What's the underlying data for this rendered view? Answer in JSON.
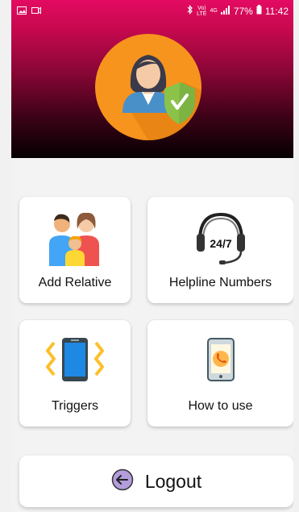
{
  "status_bar": {
    "battery": "77%",
    "time": "11:42",
    "net_label": "Vo)",
    "lte_label": "LTE",
    "g4_label": "4G"
  },
  "header": {
    "logo_icon": "woman-shield-icon"
  },
  "tiles": [
    {
      "label": "Add Relative",
      "icon": "family-icon"
    },
    {
      "label": "Helpline Numbers",
      "icon": "headset-24-7-icon"
    },
    {
      "label": "Triggers",
      "icon": "vibrating-phone-icon"
    },
    {
      "label": "How to use",
      "icon": "phone-call-icon"
    }
  ],
  "headset_text": "24/7",
  "logout": {
    "label": "Logout",
    "icon": "logout-icon"
  },
  "colors": {
    "header_top": "#e30a62",
    "header_bottom": "#050001",
    "logo_circle": "#f7941d",
    "shield": "#8bc34a",
    "triggers_blue": "#1e88e5",
    "triggers_yellow": "#fbc02d",
    "logout_purple": "#b39ddb"
  }
}
